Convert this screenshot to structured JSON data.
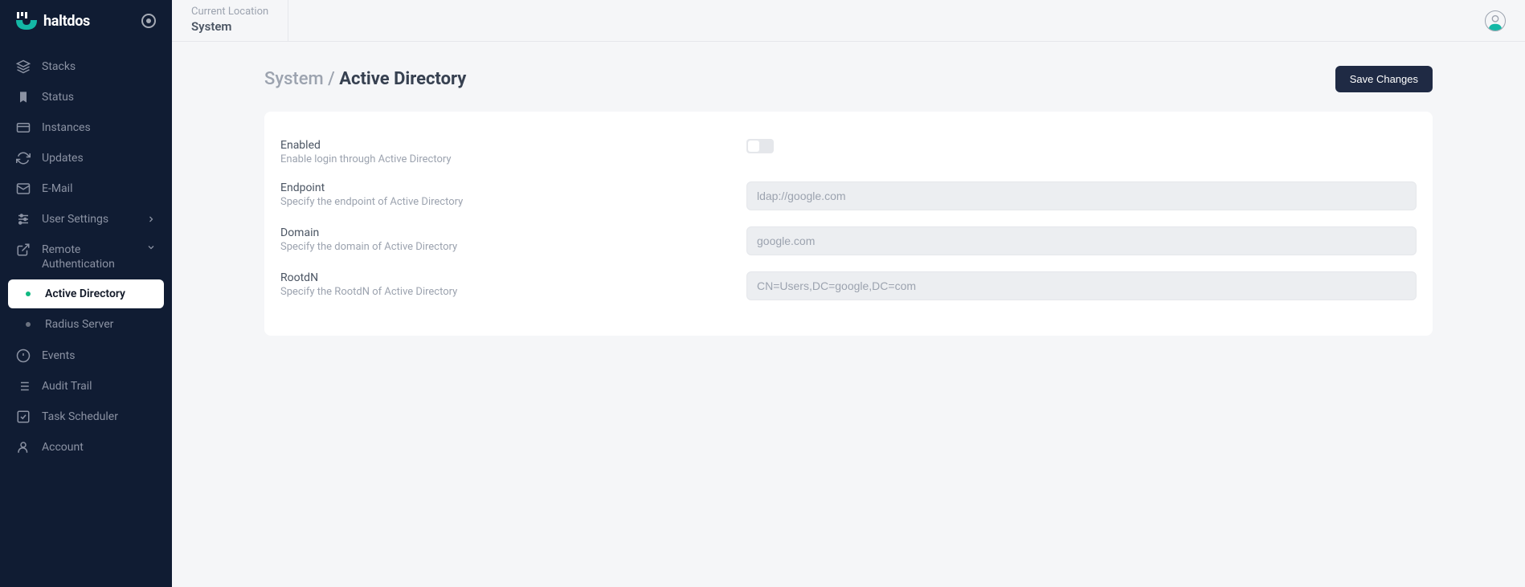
{
  "brand": "haltdos",
  "topbar": {
    "location_label": "Current Location",
    "location_value": "System"
  },
  "sidebar": {
    "items": [
      {
        "label": "Stacks"
      },
      {
        "label": "Status"
      },
      {
        "label": "Instances"
      },
      {
        "label": "Updates"
      },
      {
        "label": "E-Mail"
      },
      {
        "label": "User Settings"
      },
      {
        "label": "Remote Authentication"
      }
    ],
    "subitems": [
      {
        "label": "Active Directory"
      },
      {
        "label": "Radius Server"
      }
    ],
    "items2": [
      {
        "label": "Events"
      },
      {
        "label": "Audit Trail"
      },
      {
        "label": "Task Scheduler"
      },
      {
        "label": "Account"
      }
    ]
  },
  "breadcrumb": {
    "parent": "System",
    "separator": " / ",
    "current": "Active Directory"
  },
  "buttons": {
    "save": "Save Changes"
  },
  "form": {
    "enabled": {
      "label": "Enabled",
      "desc": "Enable login through Active Directory",
      "value": false
    },
    "endpoint": {
      "label": "Endpoint",
      "desc": "Specify the endpoint of Active Directory",
      "placeholder": "ldap://google.com",
      "value": ""
    },
    "domain": {
      "label": "Domain",
      "desc": "Specify the domain of Active Directory",
      "placeholder": "google.com",
      "value": ""
    },
    "rootdn": {
      "label": "RootdN",
      "desc": "Specify the RootdN of Active Directory",
      "placeholder": "CN=Users,DC=google,DC=com",
      "value": ""
    }
  }
}
